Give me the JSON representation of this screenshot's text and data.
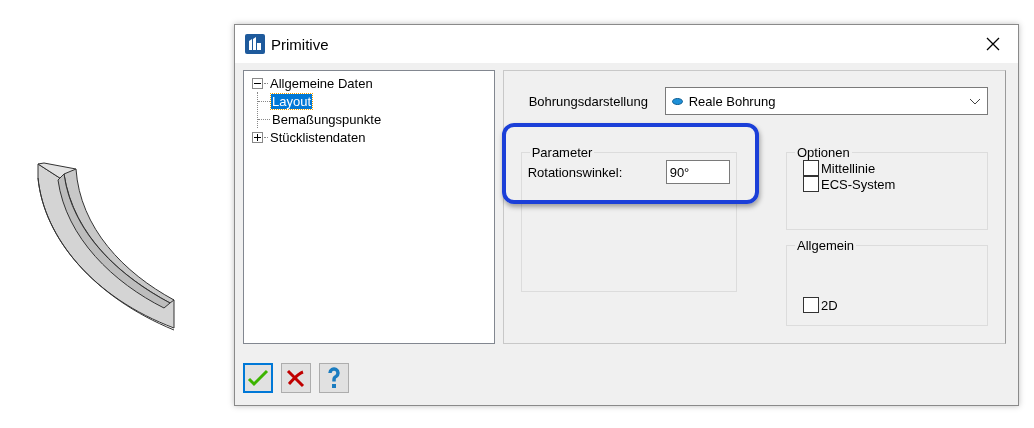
{
  "window": {
    "title": "Primitive"
  },
  "tree": [
    {
      "label": "Allgemeine Daten",
      "expanded": true,
      "selected": false,
      "children": [
        {
          "label": "Layout",
          "selected": true
        },
        {
          "label": "Bemaßungspunkte",
          "selected": false
        }
      ]
    },
    {
      "label": "Stücklistendaten",
      "expanded": false,
      "selected": false
    }
  ],
  "bohrung": {
    "label": "Bohrungsdarstellung",
    "value": "Reale Bohrung"
  },
  "parameter": {
    "title": "Parameter",
    "highlighted": true,
    "field_label": "Rotationswinkel:",
    "value": "90°"
  },
  "optionen": {
    "title": "Optionen",
    "checkboxes": [
      {
        "label": "Mittellinie",
        "checked": false
      },
      {
        "label": "ECS-System",
        "checked": false
      }
    ]
  },
  "allgemein": {
    "title": "Allgemein",
    "checkboxes": [
      {
        "label": "2D",
        "checked": false
      }
    ]
  },
  "buttons": [
    {
      "kind": "ok",
      "selected": true
    },
    {
      "kind": "cancel",
      "selected": false
    },
    {
      "kind": "help",
      "selected": false
    }
  ]
}
